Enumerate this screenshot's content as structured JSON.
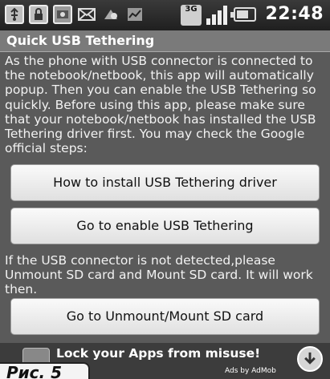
{
  "status_bar": {
    "time": "22:48",
    "network_type": "3G",
    "icons": [
      "usb-icon",
      "lock-app-icon",
      "photo-icon",
      "mail-icon",
      "notification-icon",
      "chart-icon",
      "signal-icon",
      "battery-icon"
    ]
  },
  "title": "Quick USB Tethering",
  "intro_text": "As the phone with USB connector is connected to the notebook/netbook, this app will automatically popup. Then you can enable the USB Tethering so quickly. Before using this app, please make sure that your notebook/netbook has installed the USB Tethering driver first. You may check the Google official steps:",
  "buttons": {
    "install_driver": "How to install USB Tethering driver",
    "enable_tethering": "Go to enable USB Tethering",
    "unmount_sd": "Go to Unmount/Mount SD card"
  },
  "note_text": "If the USB connector is not detected,please Unmount SD card and Mount SD card. It will work then.",
  "ad": {
    "text": "Lock your Apps from misuse!",
    "by": "Ads by AdMob"
  },
  "caption": "Рис. 5"
}
